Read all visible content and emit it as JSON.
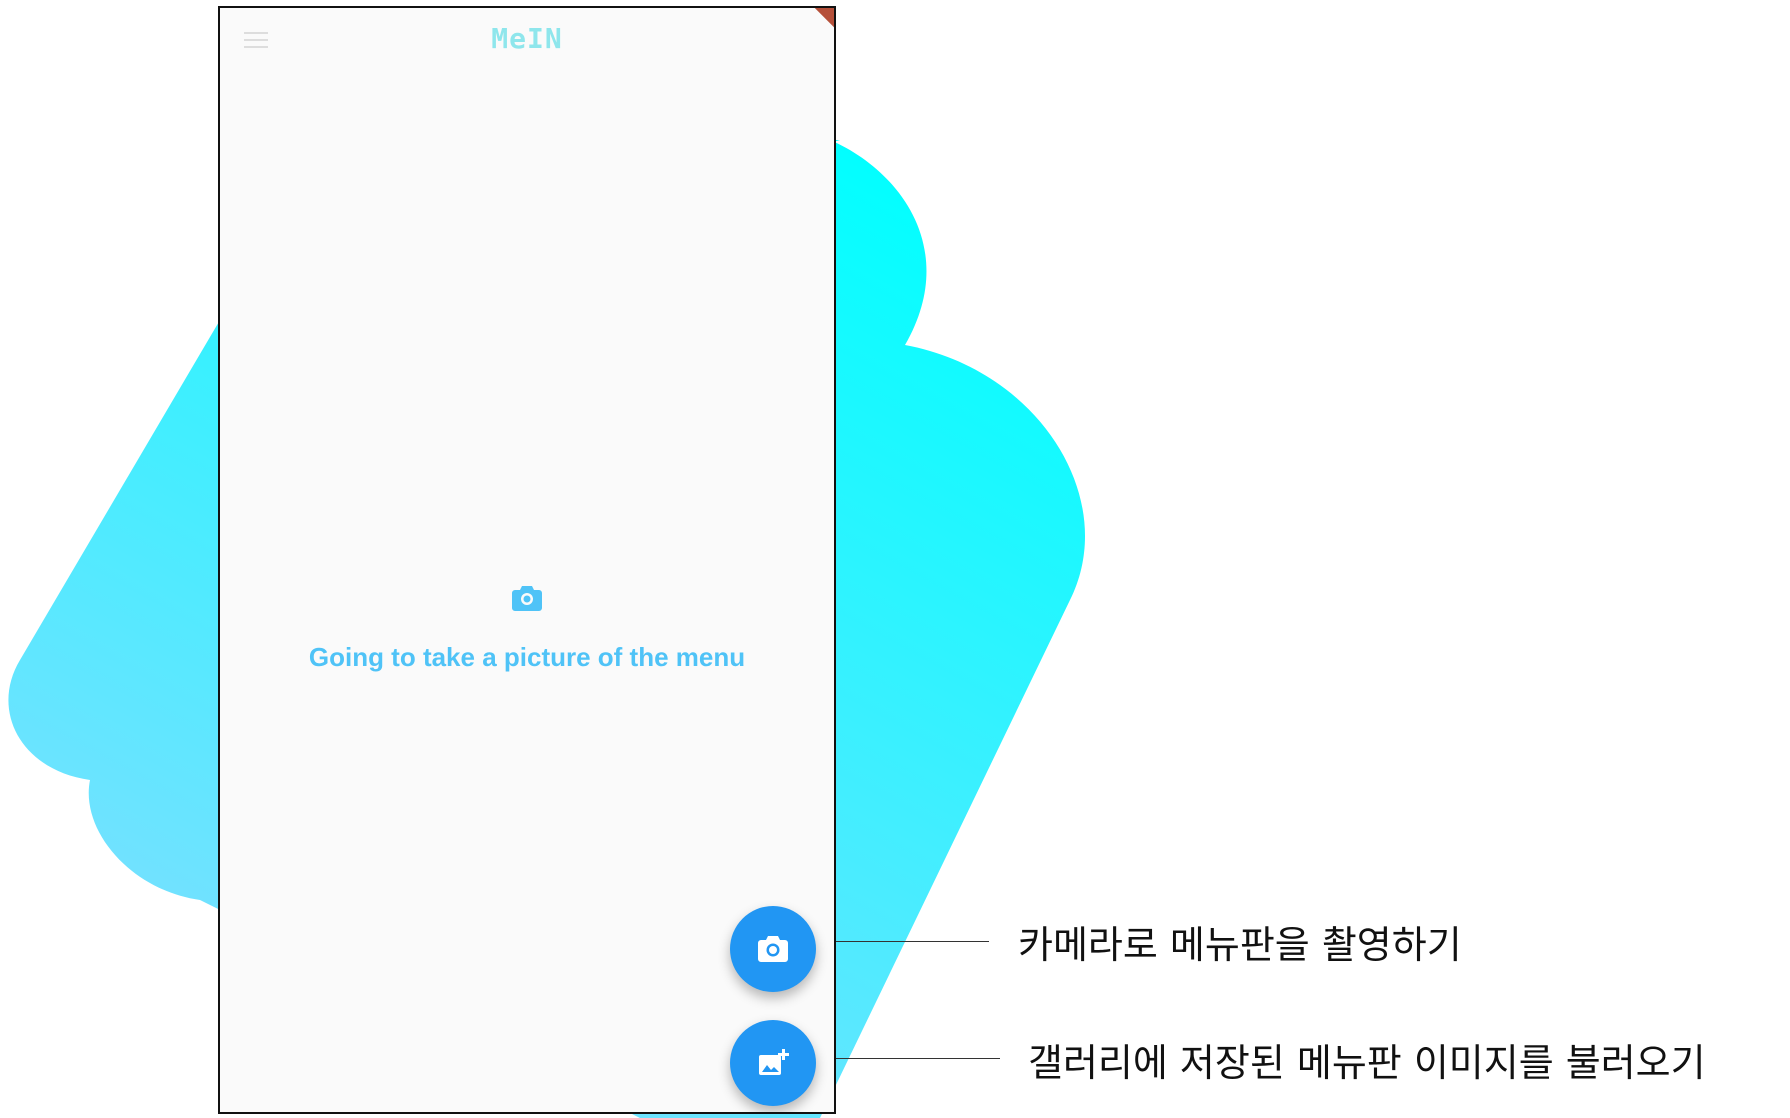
{
  "app": {
    "title": "MeIN"
  },
  "main": {
    "icon": "camera-icon",
    "hint": "Going to take a picture of the menu"
  },
  "fabs": {
    "camera_icon": "camera-icon",
    "gallery_icon": "add-photo-icon"
  },
  "annotations": {
    "camera": "카메라로 메뉴판을 촬영하기",
    "gallery": "갤러리에 저장된 메뉴판 이미지를 불러오기"
  },
  "colors": {
    "accent": "#2196f3",
    "hint_text": "#4fc3f7",
    "title": "#8ee6ec",
    "background_shape_top": "#00ffff",
    "background_shape_bottom": "#80deff"
  }
}
